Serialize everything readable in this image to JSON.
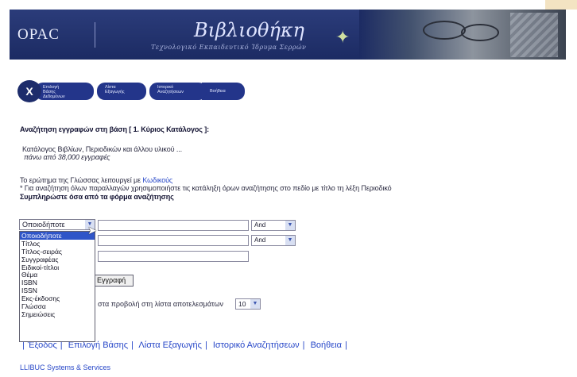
{
  "banner": {
    "opac": "OPAC",
    "title": "Βιβλιοθήκη",
    "subtitle": "Τεχνολογικό Εκπαιδευτικό Ίδρυμα Σερρών"
  },
  "nav": {
    "close_glyph": "X",
    "tab1_lines": [
      "Επιλογή",
      "Βάσης",
      "Δεδομένων"
    ],
    "tab2_lines": [
      "Λίστα",
      "Εξαγωγής"
    ],
    "tab3_lines": [
      "Ιστορικό",
      "Αναζητήσεων"
    ],
    "tab4": "Βοήθεια"
  },
  "content": {
    "heading": "Αναζήτηση εγγραφών στη βάση [ 1. Κύριος Κατάλογος ]:",
    "catalog_line1": "Κατάλογος Βιβλίων, Περιοδικών και άλλου υλικού ...",
    "catalog_line2": "πάνω από 38,000 εγγραφές",
    "info1_prefix": "Το ερώτημα της Γλώσσας λειτουργεί με ",
    "info1_link": "Κωδικούς",
    "info2": "* Για αναζήτηση όλων παραλλαγών χρησιμοποιήστε τις κατάληξη όρων αναζήτησης στο πεδίο με τίτλο τη λέξη Περιοδικό",
    "info3": "Συμπληρώστε όσα από τα φόρμα αναζήτησης"
  },
  "search": {
    "field_selected": "Οποιοδήποτε",
    "field_options": [
      "Οποιοδήποτε",
      "Τίτλος",
      "Τίτλος-σειράς",
      "Συγγραφέας",
      "Ειδικοί-τίτλοι",
      "Θέμα",
      "ISBN",
      "ISSN",
      "Εκς-έκδοσης",
      "Γλώσσα",
      "Σημειώσεις"
    ],
    "op1": "And",
    "op2": "And",
    "button_label": "Εγγραφή",
    "results_text": "στα προβολή στη λίστα αποτελεσμάτων",
    "per_page": "10"
  },
  "footer": {
    "links": [
      "Έξοδος",
      "Επιλογή Βάσης",
      "Λίστα Εξαγωγής",
      "Ιστορικό Αναζητήσεων",
      "Βοήθεια"
    ],
    "credit": "LLIBUC Systems & Services"
  },
  "colors": {
    "banner": "#1c2b63",
    "tab": "#23358a",
    "link": "#2747c8",
    "selected_option": "#2f55c8"
  },
  "icons": [
    "close-icon",
    "dropdown-arrow-icon",
    "mouse-cursor-icon",
    "star-icon"
  ]
}
